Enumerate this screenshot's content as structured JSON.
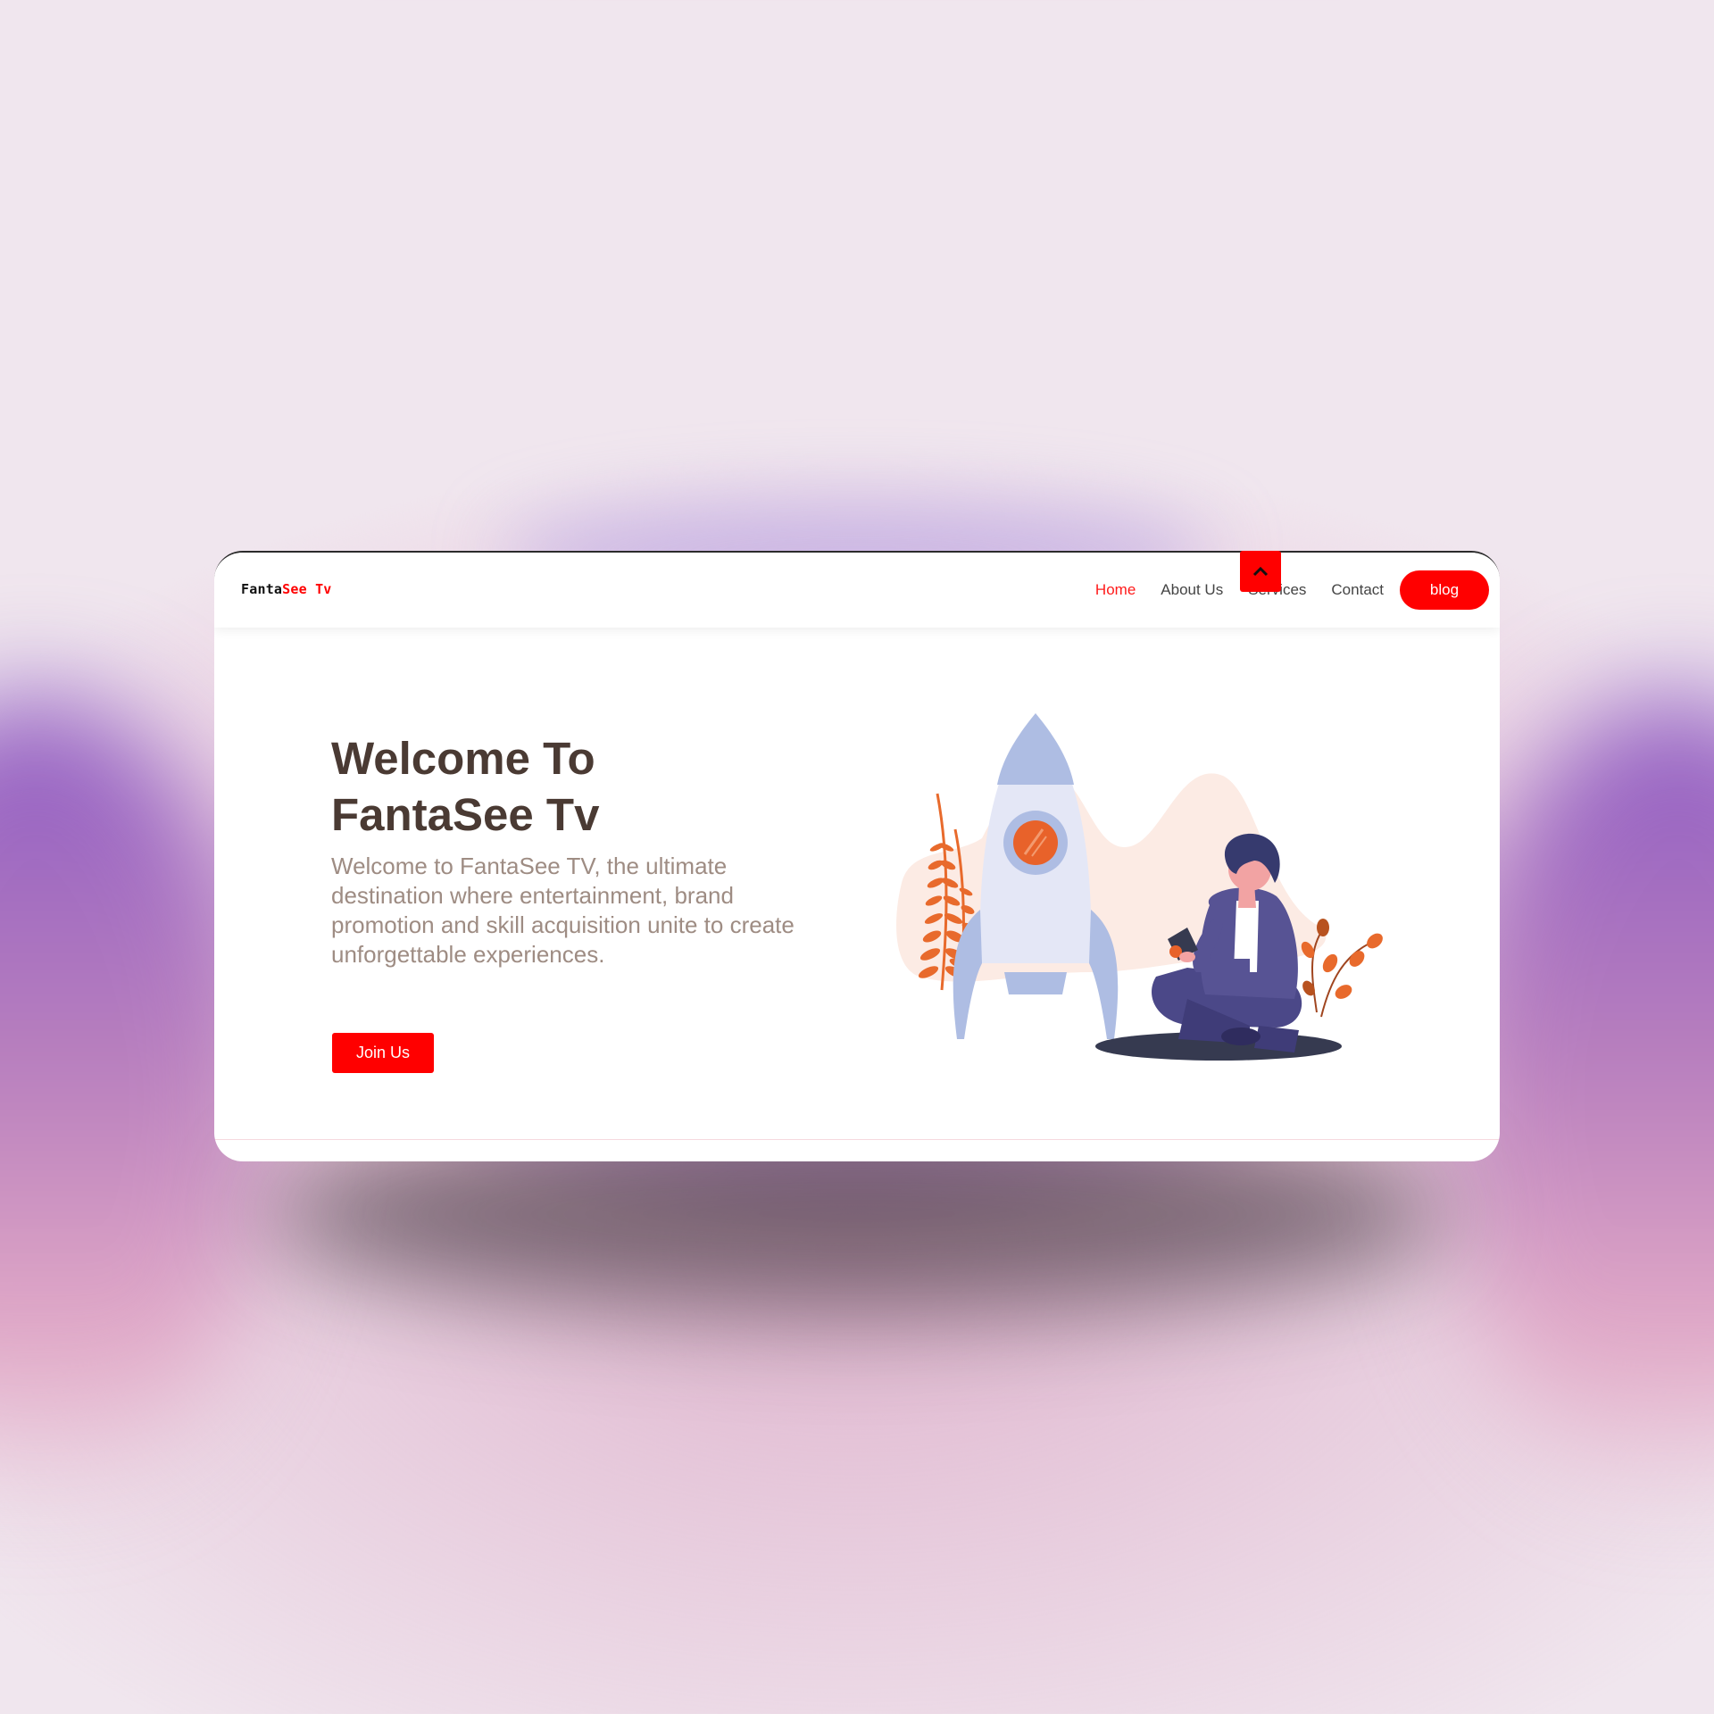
{
  "brand": {
    "name_part1": "Fanta",
    "name_part2": "See Tv",
    "accent_color": "#ff0000"
  },
  "nav": {
    "items": [
      {
        "label": "Home",
        "active": true
      },
      {
        "label": "About Us",
        "active": false
      },
      {
        "label": "Services",
        "active": false
      },
      {
        "label": "Contact",
        "active": false
      }
    ],
    "cta_label": "blog"
  },
  "hero": {
    "title_line1": "Welcome To",
    "title_line2": "FantaSee Tv",
    "description": "Welcome to FantaSee TV, the ultimate destination where entertainment, brand promotion and skill acquisition unite to create unforgettable experiences.",
    "button_label": "Join Us",
    "illustration": "person-with-rocket-illustration"
  },
  "scroll_top": {
    "icon": "chevron-up-icon"
  }
}
